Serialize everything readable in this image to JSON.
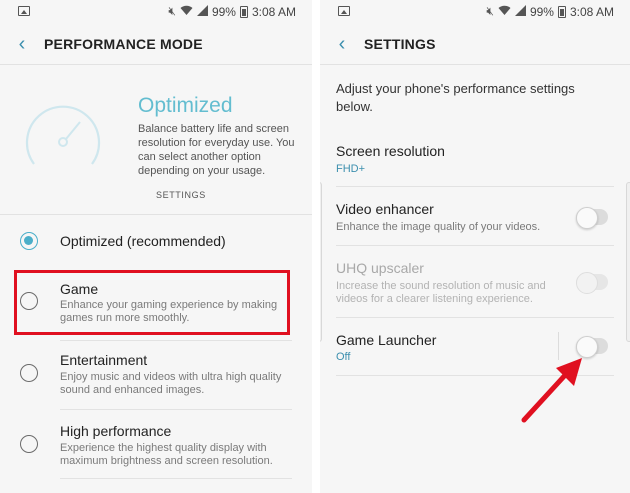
{
  "status": {
    "battery_percent_text": "99%",
    "time": "3:08 AM"
  },
  "left": {
    "title": "PERFORMANCE MODE",
    "hero": {
      "title": "Optimized",
      "description": "Balance battery life and screen resolution for everyday use. You can select another option depending on your usage.",
      "settings_link": "SETTINGS"
    },
    "options": [
      {
        "title": "Optimized (recommended)",
        "subtitle": "",
        "selected": true
      },
      {
        "title": "Game",
        "subtitle": "Enhance your gaming experience by making games run more smoothly.",
        "selected": false
      },
      {
        "title": "Entertainment",
        "subtitle": "Enjoy music and videos with ultra high quality sound and enhanced images.",
        "selected": false
      },
      {
        "title": "High performance",
        "subtitle": "Experience the highest quality display with maximum brightness and screen resolution.",
        "selected": false
      }
    ]
  },
  "right": {
    "title": "SETTINGS",
    "intro": "Adjust your phone's performance settings below.",
    "items": [
      {
        "title": "Screen resolution",
        "subtitle": "FHD+",
        "has_toggle": false,
        "enabled": true
      },
      {
        "title": "Video enhancer",
        "subtitle": "Enhance the image quality of your videos.",
        "has_toggle": true,
        "on": false,
        "enabled": true
      },
      {
        "title": "UHQ upscaler",
        "subtitle": "Increase the sound resolution of music and videos for a clearer listening experience.",
        "has_toggle": true,
        "on": false,
        "enabled": false
      },
      {
        "title": "Game Launcher",
        "subtitle": "Off",
        "has_toggle": true,
        "on": false,
        "enabled": true
      }
    ]
  },
  "colors": {
    "accent": "#4aaec9",
    "accent_text": "#3c8fae",
    "highlight": "#e01020",
    "annotation_arrow": "#e01020"
  },
  "icons": [
    "image-icon",
    "mute-icon",
    "wifi-icon",
    "signal-icon",
    "battery-icon",
    "back-arrow-icon",
    "speedometer-icon",
    "annotation-arrow-icon"
  ]
}
